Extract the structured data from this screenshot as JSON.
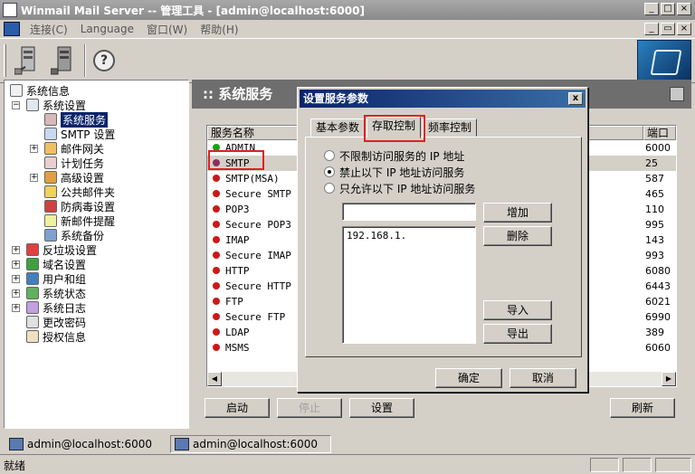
{
  "window": {
    "title": "Winmail Mail Server -- 管理工具 - [admin@localhost:6000]"
  },
  "menu": [
    "连接(C)",
    "Language",
    "窗口(W)",
    "帮助(H)"
  ],
  "toolbar": {
    "help_glyph": "?"
  },
  "tree": {
    "items": [
      {
        "label": "系统信息"
      },
      {
        "label": "系统设置"
      },
      {
        "label": "系统服务"
      },
      {
        "label": "SMTP 设置"
      },
      {
        "label": "邮件网关"
      },
      {
        "label": "计划任务"
      },
      {
        "label": "高级设置"
      },
      {
        "label": "公共邮件夹"
      },
      {
        "label": "防病毒设置"
      },
      {
        "label": "新邮件提醒"
      },
      {
        "label": "系统备份"
      },
      {
        "label": "反垃圾设置"
      },
      {
        "label": "域名设置"
      },
      {
        "label": "用户和组"
      },
      {
        "label": "系统状态"
      },
      {
        "label": "系统日志"
      },
      {
        "label": "更改密码"
      },
      {
        "label": "授权信息"
      }
    ]
  },
  "panel": {
    "title": ":: 系统服务"
  },
  "service_list": {
    "col_name": "服务名称",
    "col_port": "端口",
    "rows": [
      {
        "name": "ADMIN",
        "port": "6000",
        "status": "green"
      },
      {
        "name": "SMTP",
        "port": "25",
        "status": "purple"
      },
      {
        "name": "SMTP(MSA)",
        "port": "587",
        "status": "red"
      },
      {
        "name": "Secure SMTP",
        "port": "465",
        "status": "red"
      },
      {
        "name": "POP3",
        "port": "110",
        "status": "red"
      },
      {
        "name": "Secure POP3",
        "port": "995",
        "status": "red"
      },
      {
        "name": "IMAP",
        "port": "143",
        "status": "red"
      },
      {
        "name": "Secure IMAP",
        "port": "993",
        "status": "red"
      },
      {
        "name": "HTTP",
        "port": "6080",
        "status": "red"
      },
      {
        "name": "Secure HTTP",
        "port": "6443",
        "status": "red"
      },
      {
        "name": "FTP",
        "port": "6021",
        "status": "red"
      },
      {
        "name": "Secure FTP",
        "port": "6990",
        "status": "red"
      },
      {
        "name": "LDAP",
        "port": "389",
        "status": "red"
      },
      {
        "name": "MSMS",
        "port": "6060",
        "status": "red"
      }
    ]
  },
  "buttons": {
    "start": "启动",
    "stop": "停止",
    "settings": "设置",
    "refresh": "刷新"
  },
  "dialog": {
    "title": "设置服务参数",
    "close": "x",
    "tabs": [
      "基本参数",
      "存取控制",
      "频率控制"
    ],
    "radios": [
      {
        "label": "不限制访问服务的 IP 地址",
        "checked": false
      },
      {
        "label": "禁止以下 IP 地址访问服务",
        "checked": true
      },
      {
        "label": "只允许以下 IP 地址访问服务",
        "checked": false
      }
    ],
    "ip_input": "",
    "ip_list": [
      "192.168.1."
    ],
    "add": "增加",
    "delete": "删除",
    "import": "导入",
    "export": "导出",
    "ok": "确定",
    "cancel": "取消"
  },
  "connections": [
    "admin@localhost:6000",
    "admin@localhost:6000"
  ],
  "status": {
    "text": "就绪"
  },
  "colors": {
    "red": "#cc1818",
    "green": "#18a018",
    "purple": "#8a3060",
    "selection": "#0a246a",
    "highlight_outline": "#e02020"
  }
}
